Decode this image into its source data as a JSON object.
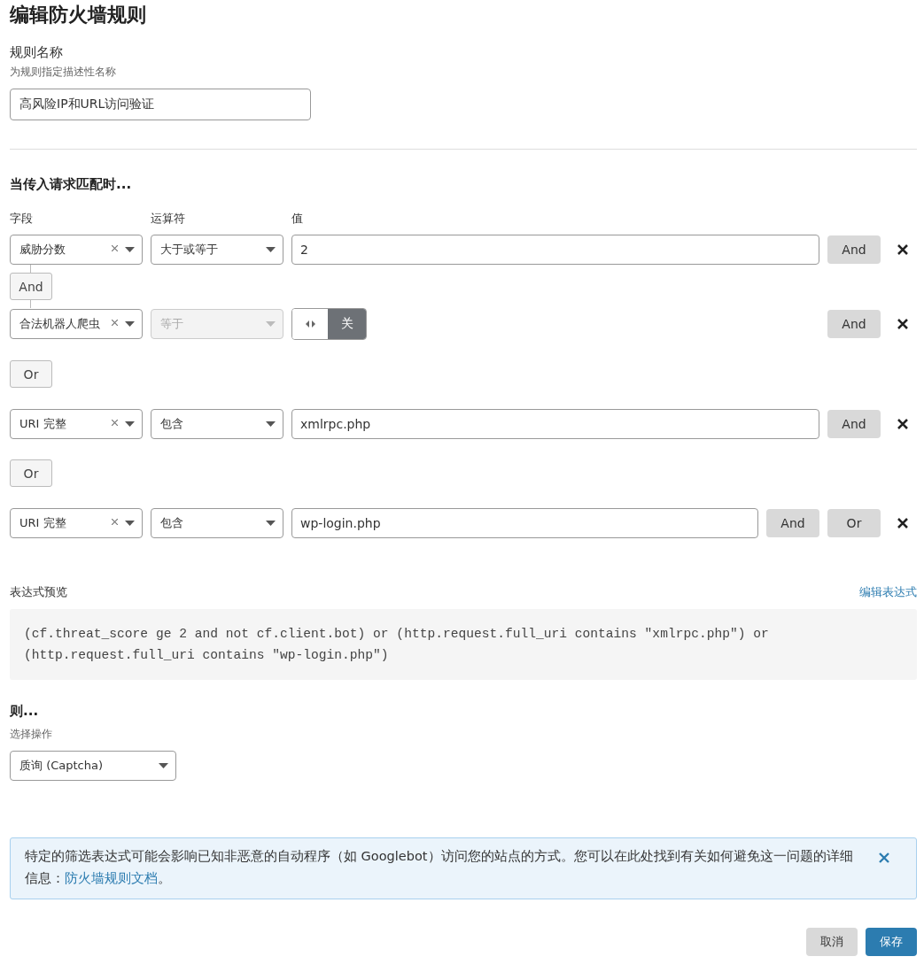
{
  "title": "编辑防火墙规则",
  "rule_name": {
    "label": "规则名称",
    "hint": "为规则指定描述性名称",
    "value": "高风险IP和URL访问验证"
  },
  "match": {
    "heading": "当传入请求匹配时...",
    "columns": [
      "字段",
      "运算符",
      "值"
    ],
    "groups": [
      {
        "join": "And",
        "conditions": [
          {
            "field": "威胁分数",
            "operator": {
              "text": "大于或等于",
              "disabled": false
            },
            "value": {
              "kind": "text",
              "text": "2"
            },
            "actions": [
              "And"
            ]
          },
          {
            "field": "合法机器人爬虫",
            "operator": {
              "text": "等于",
              "disabled": true
            },
            "value": {
              "kind": "toggle",
              "text": "关",
              "on": false
            },
            "actions": [
              "And"
            ]
          }
        ]
      },
      {
        "separator": "Or",
        "conditions": [
          {
            "field": "URI 完整",
            "operator": {
              "text": "包含",
              "disabled": false
            },
            "value": {
              "kind": "text",
              "text": "xmlrpc.php"
            },
            "actions": [
              "And"
            ]
          }
        ]
      },
      {
        "separator": "Or",
        "conditions": [
          {
            "field": "URI 完整",
            "operator": {
              "text": "包含",
              "disabled": false
            },
            "value": {
              "kind": "text",
              "text": "wp-login.php"
            },
            "actions": [
              "And",
              "Or"
            ]
          }
        ]
      }
    ]
  },
  "expression": {
    "label": "表达式预览",
    "edit_link": "编辑表达式",
    "code": "(cf.threat_score ge 2 and not cf.client.bot) or (http.request.full_uri contains \"xmlrpc.php\") or (http.request.full_uri contains \"wp-login.php\")"
  },
  "then": {
    "heading": "则...",
    "hint": "选择操作",
    "action": "质询 (Captcha)"
  },
  "alert": {
    "text": "特定的筛选表达式可能会影响已知非恶意的自动程序（如 Googlebot）访问您的站点的方式。您可以在此处找到有关如何避免这一问题的详细信息：",
    "link": "防火墙规则文档",
    "tail": "。"
  },
  "buttons": {
    "cancel": "取消",
    "save": "保存"
  }
}
